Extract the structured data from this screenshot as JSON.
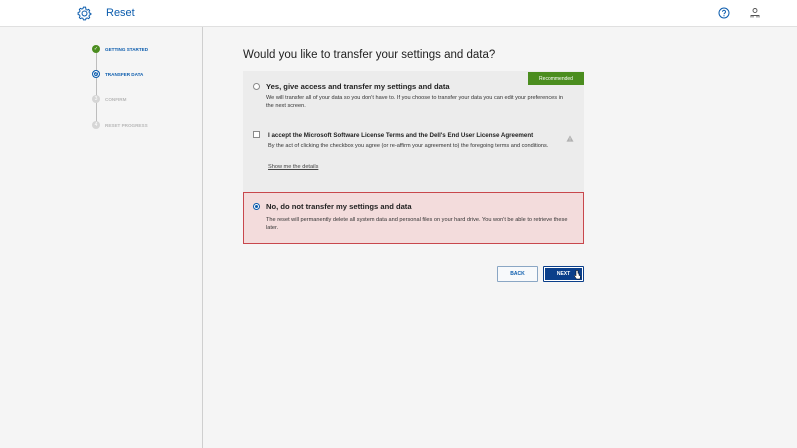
{
  "app": {
    "title": "Reset"
  },
  "steps": [
    {
      "label": "GETTING STARTED",
      "state": "done",
      "marker": "✓"
    },
    {
      "label": "TRANSFER DATA",
      "state": "active",
      "marker": "2"
    },
    {
      "label": "CONFIRM",
      "state": "todo",
      "marker": "3"
    },
    {
      "label": "RESET PROGRESS",
      "state": "todo",
      "marker": "4"
    }
  ],
  "main": {
    "question": "Would you like to transfer your settings and data?",
    "option_yes": {
      "title": "Yes, give access and transfer my settings and data",
      "desc": "We will transfer all of your data so you don't have to. If you choose to transfer your data you can edit your preferences in the next screen.",
      "badge": "Recommended",
      "checked": false
    },
    "license": {
      "title": "I accept the Microsoft Software License Terms and the Dell's End User License Agreement",
      "desc": "By the act of clicking the checkbox you agree (or re-affirm your agreement to) the foregoing terms and conditions.",
      "link": "Show me the details",
      "checked": false
    },
    "option_no": {
      "title": "No, do not transfer my settings and data",
      "desc": "The reset will permanently delete all system data and personal files on your hard drive. You won't be able to retrieve these later.",
      "checked": true
    },
    "back_label": "BACK",
    "next_label": "NEXT"
  },
  "colors": {
    "accent": "#0b5cad",
    "success": "#4b8d1f",
    "danger": "#c8474c",
    "danger_bg": "#f3dcdc"
  },
  "icons": {
    "header_left": "gear-icon",
    "help": "help-icon",
    "account": "account-icon",
    "warning": "warning-icon"
  }
}
